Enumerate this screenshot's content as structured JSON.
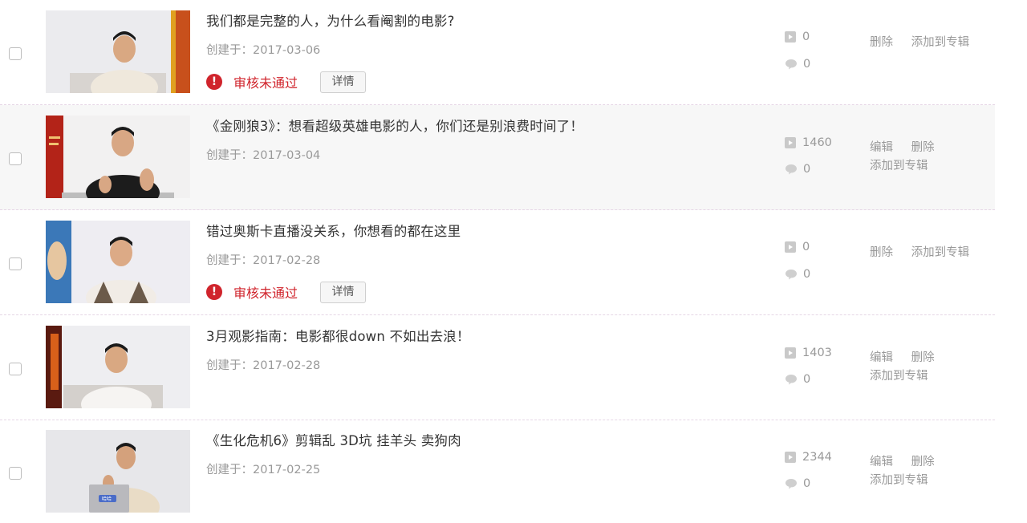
{
  "videos": [
    {
      "title": "我们都是完整的人，为什么看阉割的电影?",
      "created": "创建于：2017-03-06",
      "plays": "0",
      "comments": "0",
      "status": "审核未通过",
      "detail_label": "详情",
      "actions": [
        "删除",
        "添加到专辑"
      ]
    },
    {
      "title": "《金刚狼3》：想看超级英雄电影的人，你们还是别浪费时间了！",
      "created": "创建于：2017-03-04",
      "plays": "1460",
      "comments": "0",
      "actions_line1": [
        "编辑",
        "删除"
      ],
      "actions_line2": "添加到专辑"
    },
    {
      "title": "错过奥斯卡直播没关系，你想看的都在这里",
      "created": "创建于：2017-02-28",
      "plays": "0",
      "comments": "0",
      "status": "审核未通过",
      "detail_label": "详情",
      "actions": [
        "删除",
        "添加到专辑"
      ]
    },
    {
      "title": "3月观影指南：电影都很down 不如出去浪！",
      "created": "创建于：2017-02-28",
      "plays": "1403",
      "comments": "0",
      "actions_line1": [
        "编辑",
        "删除"
      ],
      "actions_line2": "添加到专辑"
    },
    {
      "title": "《生化危机6》剪辑乱 3D坑 挂羊头 卖狗肉",
      "created": "创建于：2017-02-25",
      "plays": "2344",
      "comments": "0",
      "actions_line1": [
        "编辑",
        "删除"
      ],
      "actions_line2": "添加到专辑"
    }
  ],
  "thumb_watermark": "哈哈",
  "colors": {
    "status_red": "#d0242c",
    "muted_text": "#999999",
    "row_shade": "#f7f7f7"
  },
  "icons": {
    "warn": "exclamation-circle-icon",
    "plays": "play-icon",
    "comments": "comment-bubble-icon"
  }
}
